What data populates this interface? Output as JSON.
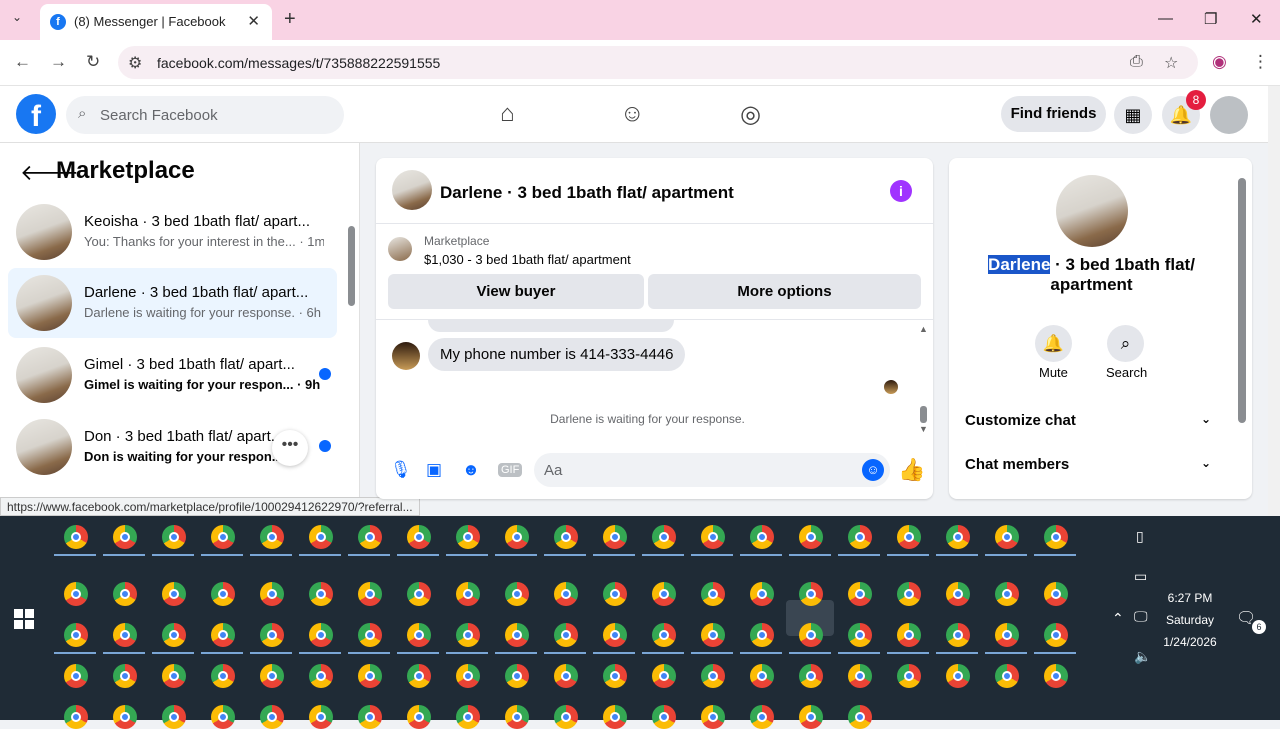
{
  "browser": {
    "tab_title": "(8) Messenger | Facebook",
    "url": "facebook.com/messages/t/735888222591555",
    "status_url": "https://www.facebook.com/marketplace/profile/100029412622970/?referral..."
  },
  "header": {
    "search_placeholder": "Search Facebook",
    "find_friends": "Find friends",
    "notifications_count": "8"
  },
  "sidebar": {
    "title": "Marketplace",
    "conversations": [
      {
        "name": "Keoisha · 3 bed 1bath flat/ apart...",
        "preview": "You: Thanks for your interest in the... · 1m",
        "unread": false
      },
      {
        "name": "Darlene · 3 bed 1bath flat/ apart...",
        "preview": "Darlene is waiting for your response. · 6h",
        "unread": false
      },
      {
        "name": "Gimel · 3 bed 1bath flat/ apart...",
        "preview": "Gimel is waiting for your respon... · 9h",
        "unread": true
      },
      {
        "name": "Don · 3 bed 1bath flat/ apart...",
        "preview": "Don is waiting for your respon...",
        "unread": true
      }
    ]
  },
  "chat": {
    "title": "Darlene · 3 bed 1bath flat/ apartment",
    "marketplace_label": "Marketplace",
    "listing": "$1,030 - 3 bed 1bath flat/ apartment",
    "view_buyer": "View buyer",
    "more_options": "More options",
    "message": "My phone number is 414-333-4446",
    "waiting": "Darlene is waiting for your response.",
    "composer_placeholder": "Aa"
  },
  "right_panel": {
    "name_highlight": "Darlene",
    "title_rest": " · 3 bed 1bath flat/ apartment",
    "mute": "Mute",
    "search": "Search",
    "customize_chat": "Customize chat",
    "chat_members": "Chat members"
  },
  "tray": {
    "time": "6:27 PM",
    "day": "Saturday",
    "date": "1/24/2026",
    "notification_count": "6"
  },
  "colors": {
    "fb_blue": "#1877f2",
    "messenger_blue": "#0866ff",
    "badge_red": "#e41e3f",
    "taskbar": "#1f2b36",
    "tab_strip": "#f9d3e4"
  }
}
